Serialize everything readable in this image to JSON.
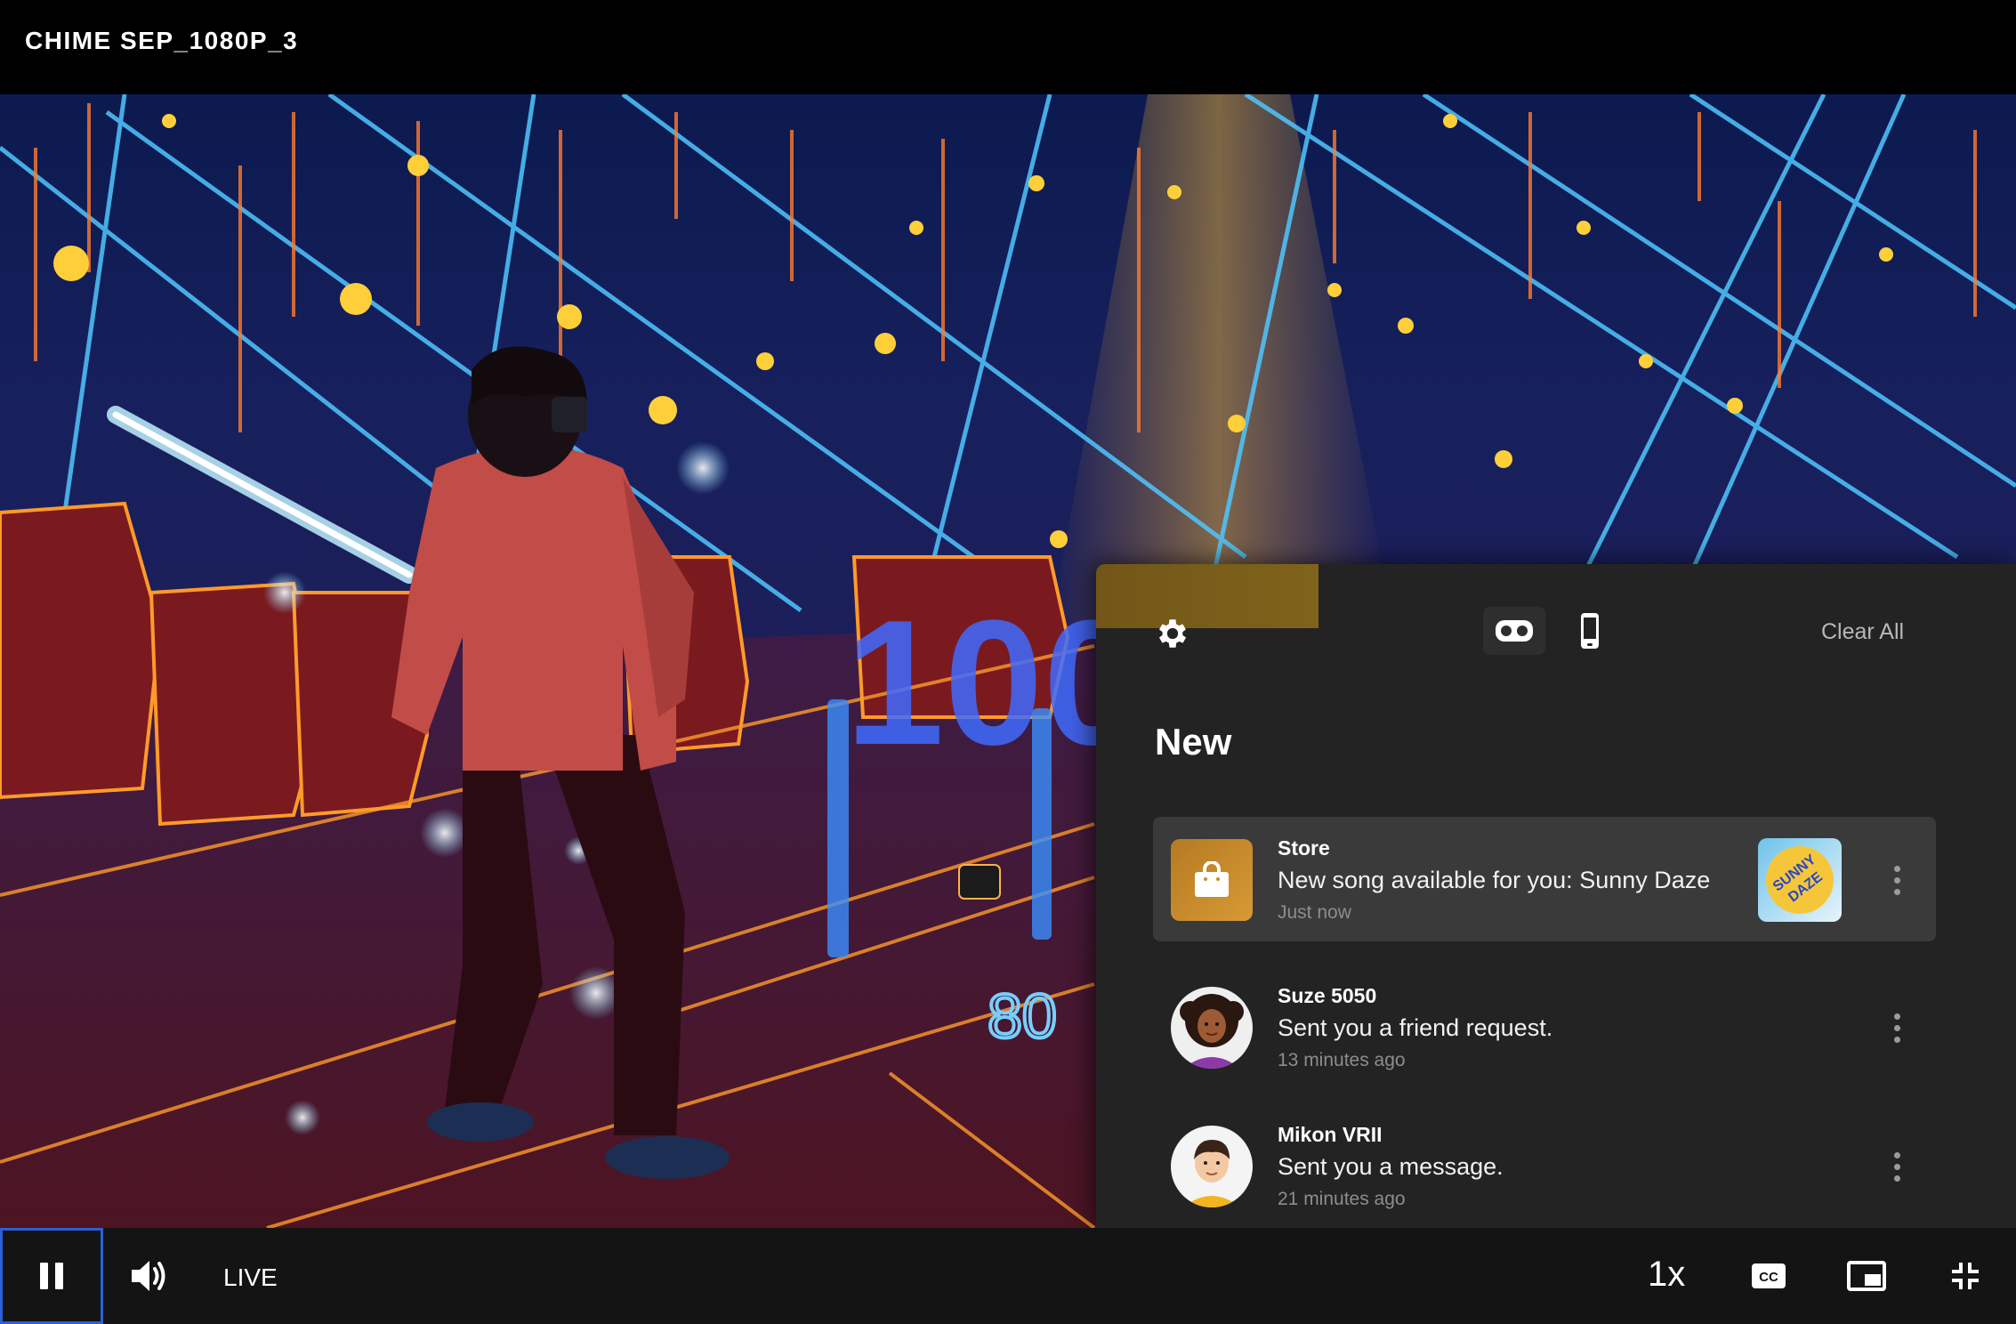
{
  "video": {
    "title": "CHIME SEP_1080P_3",
    "scene_number_1": "100",
    "scene_number_2": "80"
  },
  "notifications": {
    "tabs": {
      "settings_icon": "gear-icon",
      "vr_icon": "vr-headset-icon",
      "phone_icon": "phone-icon"
    },
    "clear_all_label": "Clear All",
    "section_title": "New",
    "items": [
      {
        "source": "Store",
        "message": "New song available for you: Sunny Daze",
        "time": "Just now",
        "icon": "shopping-bag-icon",
        "thumb_text": "SUNNY DAZE"
      },
      {
        "source": "Suze 5050",
        "message": "Sent you a friend request.",
        "time": "13 minutes ago",
        "icon": "avatar"
      },
      {
        "source": "Mikon VRII",
        "message": "Sent you a message.",
        "time": "21 minutes ago",
        "icon": "avatar"
      }
    ]
  },
  "controls": {
    "live_label": "LIVE",
    "speed_label": "1x",
    "icons": [
      "pause-icon",
      "volume-icon",
      "closed-captions-icon",
      "picture-in-picture-icon",
      "exit-fullscreen-icon"
    ]
  },
  "colors": {
    "panel_bg": "#232323",
    "highlight_bg": "#3a3a3a",
    "accent_blue": "#2a5fd8",
    "store_orange": "#c98a2c"
  }
}
